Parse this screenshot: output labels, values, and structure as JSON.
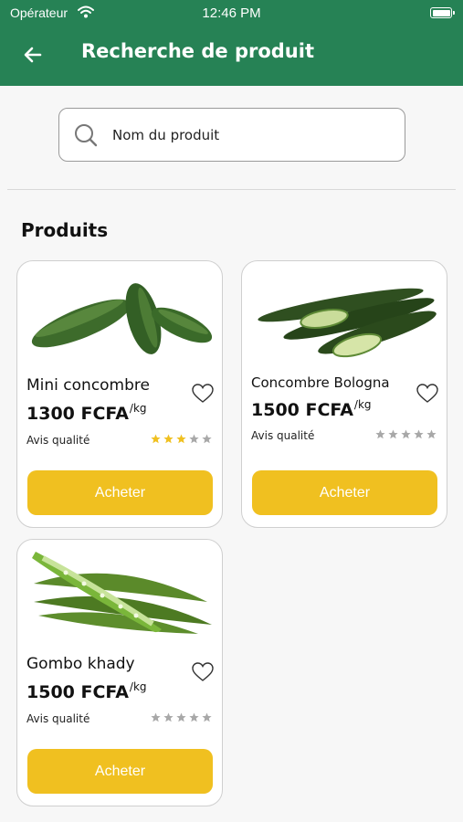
{
  "status_bar": {
    "carrier": "Opérateur",
    "time": "12:46 PM"
  },
  "header": {
    "title": "Recherche de produit",
    "back_icon": "arrow-left-icon"
  },
  "search": {
    "placeholder": "Nom du produit",
    "value": ""
  },
  "section": {
    "title": "Produits"
  },
  "colors": {
    "brand": "#268255",
    "accent": "#f0c020",
    "star_on": "#f0c020",
    "star_off": "#a8a8a8"
  },
  "products": [
    {
      "name": "Mini concombre",
      "price": "1300 FCFA",
      "unit": "/kg",
      "quality_label": "Avis qualité",
      "rating": 3,
      "max_rating": 5,
      "buy_label": "Acheter"
    },
    {
      "name": "Concombre Bologna",
      "price": "1500 FCFA",
      "unit": "/kg",
      "quality_label": "Avis qualité",
      "rating": 0,
      "max_rating": 5,
      "buy_label": "Acheter"
    },
    {
      "name": "Gombo khady",
      "price": "1500 FCFA",
      "unit": "/kg",
      "quality_label": "Avis qualité",
      "rating": 0,
      "max_rating": 5,
      "buy_label": "Acheter"
    }
  ]
}
